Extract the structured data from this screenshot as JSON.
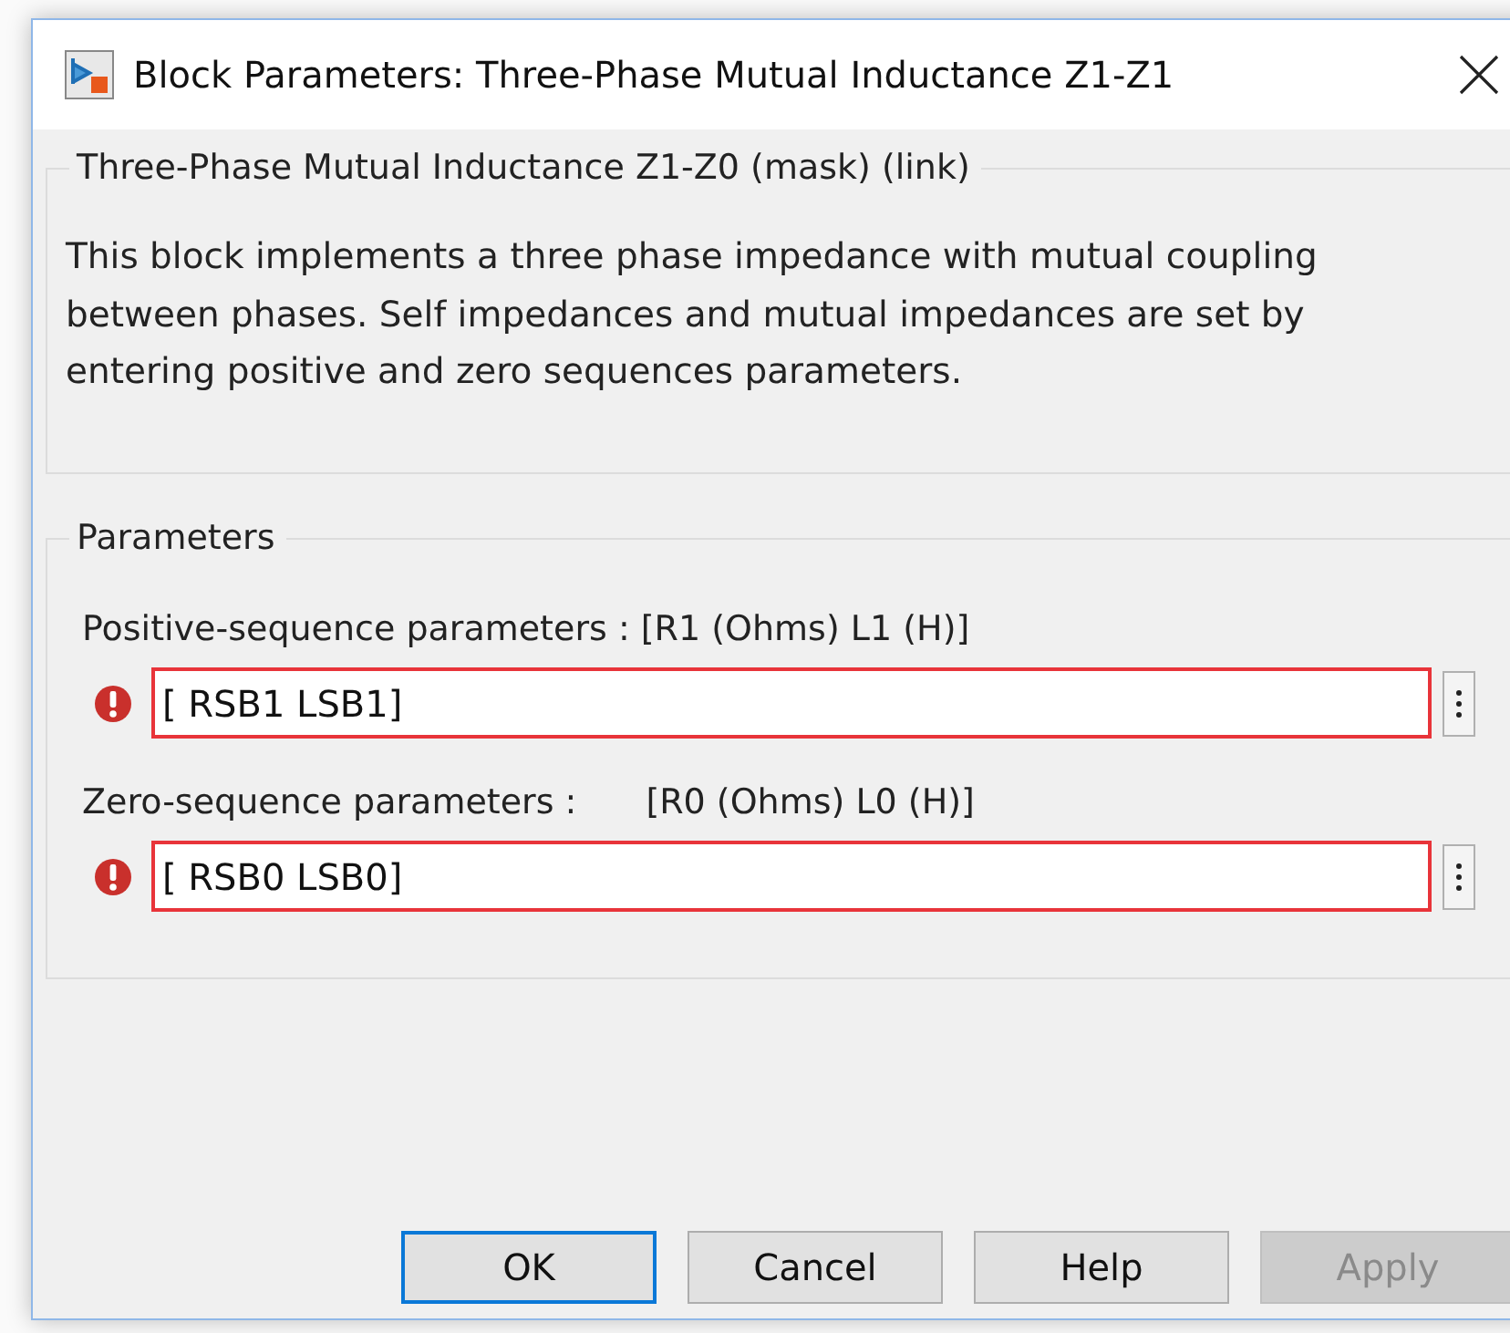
{
  "window": {
    "title": "Block Parameters: Three-Phase Mutual Inductance Z1-Z1"
  },
  "description_group": {
    "title": "Three-Phase Mutual Inductance Z1-Z0 (mask) (link)",
    "text": "This block implements a three phase impedance with mutual coupling between phases.  Self impedances and mutual impedances are set by entering positive and zero sequences parameters."
  },
  "parameters_group": {
    "title": "Parameters",
    "fields": [
      {
        "label": "Positive-sequence parameters : ",
        "units": "[R1 (Ohms) L1 (H)]",
        "value": "[ RSB1 LSB1]",
        "error": true
      },
      {
        "label": "Zero-sequence parameters :",
        "units": "[R0 (Ohms) L0 (H)]",
        "value": "[ RSB0 LSB0]",
        "error": true
      }
    ]
  },
  "buttons": [
    {
      "label": "OK",
      "default": true,
      "disabled": false
    },
    {
      "label": "Cancel",
      "default": false,
      "disabled": false
    },
    {
      "label": "Help",
      "default": false,
      "disabled": false
    },
    {
      "label": "Apply",
      "default": false,
      "disabled": true
    }
  ]
}
